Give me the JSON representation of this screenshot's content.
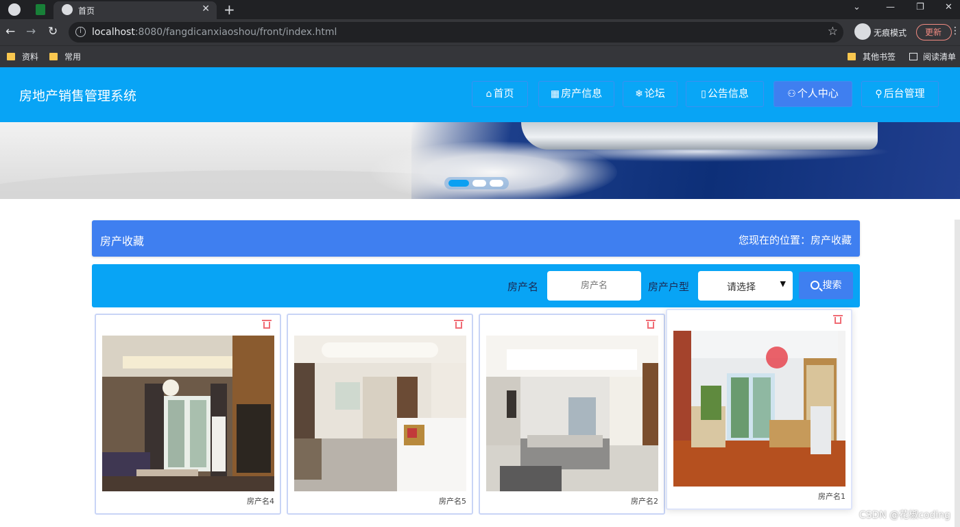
{
  "browser": {
    "tab_title": "首页",
    "url_host": "localhost",
    "url_rest": ":8080/fangdicanxiaoshou/front/index.html",
    "incognito_label": "无痕模式",
    "update_label": "更新",
    "bookmarks": [
      {
        "label": "资料"
      },
      {
        "label": "常用"
      }
    ],
    "other_bookmarks": "其他书签",
    "reading_list": "阅读清单"
  },
  "site": {
    "title": "房地产销售管理系统",
    "nav": [
      {
        "label": "首页",
        "icon": "home-icon",
        "glyph": "⌂"
      },
      {
        "label": "房产信息",
        "icon": "grid-icon",
        "glyph": "▦"
      },
      {
        "label": "论坛",
        "icon": "snowflake-icon",
        "glyph": "❄"
      },
      {
        "label": "公告信息",
        "icon": "notice-icon",
        "glyph": "▯"
      },
      {
        "label": "个人中心",
        "icon": "user-icon",
        "glyph": "⚇"
      },
      {
        "label": "后台管理",
        "icon": "link-icon",
        "glyph": "⚲"
      }
    ],
    "active_nav": "个人中心"
  },
  "panel": {
    "title": "房产收藏",
    "location": "您现在的位置：房产收藏"
  },
  "search": {
    "name_label": "房产名",
    "name_placeholder": "房产名",
    "type_label": "房产户型",
    "type_value": "请选择",
    "button_label": "搜索"
  },
  "cards": [
    {
      "name": "房产名4"
    },
    {
      "name": "房产名5"
    },
    {
      "name": "房产名2"
    },
    {
      "name": "房产名1"
    }
  ],
  "watermark": "CSDN @花椒coding",
  "colors": {
    "header_blue": "#08a4f5",
    "accent_blue": "#3f7ff0",
    "delete_red": "#f06b74"
  }
}
